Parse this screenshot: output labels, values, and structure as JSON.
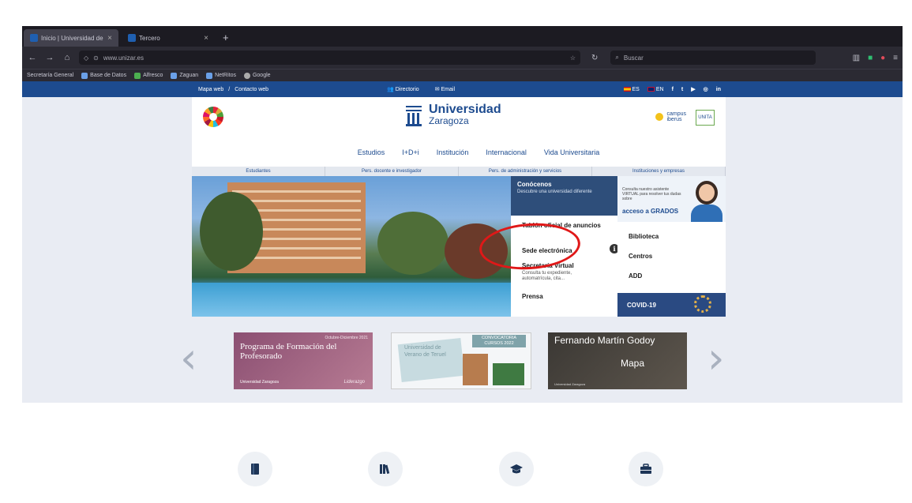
{
  "browser": {
    "tabs": [
      {
        "label": "Inicio | Universidad de Zaragoza"
      },
      {
        "label": "Tercero"
      }
    ],
    "new_tab": "+",
    "url": "www.unizar.es",
    "search_placeholder": "Buscar",
    "bookmarks": [
      {
        "label": "Secretaría General"
      },
      {
        "label": "Base de Datos"
      },
      {
        "label": "Alfresco"
      },
      {
        "label": "Zaguan"
      },
      {
        "label": "NetRitos"
      },
      {
        "label": "Google"
      }
    ]
  },
  "site": {
    "topbar": {
      "left": [
        "Mapa web",
        "/",
        "Contacto web"
      ],
      "directory": "Directorio",
      "email": "Email",
      "lang_es": "ES",
      "lang_en": "EN",
      "social": [
        "f",
        "t",
        "▶",
        "◎",
        "in"
      ]
    },
    "logo": {
      "line1": "Universidad",
      "line2": "Zaragoza"
    },
    "campus": {
      "line1": "campus",
      "line2": "iberus"
    },
    "unita": "UNITA",
    "main_nav": [
      "Estudios",
      "I+D+i",
      "Institución",
      "Internacional",
      "Vida Universitaria"
    ],
    "sub_nav": [
      "Estudiantes",
      "Pers. docente e investigador",
      "Pers. de administración y servicios",
      "Instituciones y empresas"
    ],
    "conocenos": {
      "title": "Conócenos",
      "subtitle": "Descubre una universidad diferente"
    },
    "mid_links": {
      "tablon": "Tablón oficial de anuncios",
      "sede": "Sede electrónica",
      "secretaria": "Secretaría Virtual",
      "secretaria_sub": "Consulta tu expediente, automatrícula, cita...",
      "prensa": "Prensa",
      "info": "i"
    },
    "grados": {
      "text": "Consulta nuestro asistente VIRTUAL para resolver tus dudas sobre",
      "cta": "acceso a GRADOS"
    },
    "right_links": [
      "Biblioteca",
      "Centros",
      "ADD"
    ],
    "covid": "COVID-19",
    "carousel": {
      "prev": "‹",
      "next": "›",
      "card1": {
        "title": "Programa de Formación del Profesorado",
        "dates": "Octubre-Diciembre 2021",
        "brand": "Universidad Zaragoza",
        "tag": "Liderazgo"
      },
      "card2": {
        "tag": "CONVOCATORIA CURSOS 2022",
        "bg": "Universidad de Verano de Teruel"
      },
      "card3": {
        "name": "Fernando Martín Godoy",
        "mapa": "Mapa",
        "sub": "Universidad Zaragoza"
      }
    }
  },
  "bottom_icons": [
    {
      "name": "book-icon"
    },
    {
      "name": "library-icon"
    },
    {
      "name": "graduation-cap-icon"
    },
    {
      "name": "briefcase-icon"
    }
  ]
}
